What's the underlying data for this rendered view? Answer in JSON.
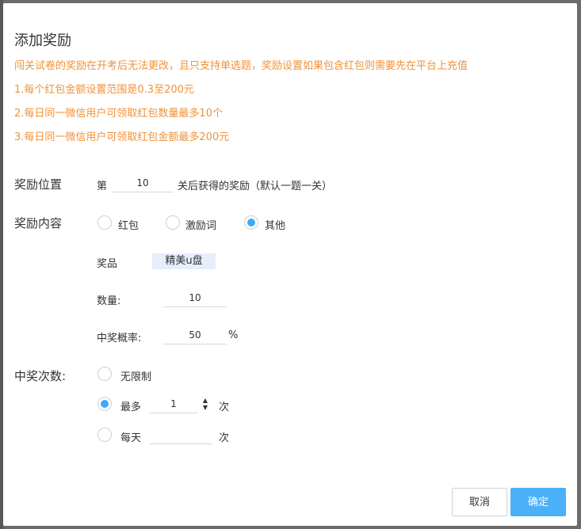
{
  "modal": {
    "title": "添加奖励",
    "notices": [
      "闯关试卷的奖励在开考后无法更改，且只支持单选题，奖励设置如果包含红包则需要先在平台上充值",
      "1.每个红包金额设置范围是0.3至200元",
      "2.每日同一微信用户可领取红包数量最多10个",
      "3.每日同一微信用户可领取红包金额最多200元"
    ]
  },
  "position": {
    "label": "奖励位置",
    "prefix": "第",
    "value": "10",
    "suffix": "关后获得的奖励（默认一题一关）"
  },
  "content": {
    "label": "奖励内容",
    "options": [
      "红包",
      "激励词",
      "其他"
    ],
    "selected": "其他",
    "prize_label": "奖品",
    "prize_value": "精美u盘",
    "quantity_label": "数量:",
    "quantity_value": "10",
    "probability_label": "中奖概率:",
    "probability_value": "50",
    "probability_unit": "%"
  },
  "times": {
    "label": "中奖次数:",
    "unlimited_label": "无限制",
    "max_label": "最多",
    "max_value": "1",
    "max_unit": "次",
    "daily_label": "每天",
    "daily_value": "",
    "daily_unit": "次",
    "selected": "最多"
  },
  "footer": {
    "cancel_label": "取消",
    "ok_label": "确定"
  },
  "colors": {
    "accent": "#3fa9f5",
    "notice": "#f0923a",
    "primary_button": "#4bb0f8"
  }
}
